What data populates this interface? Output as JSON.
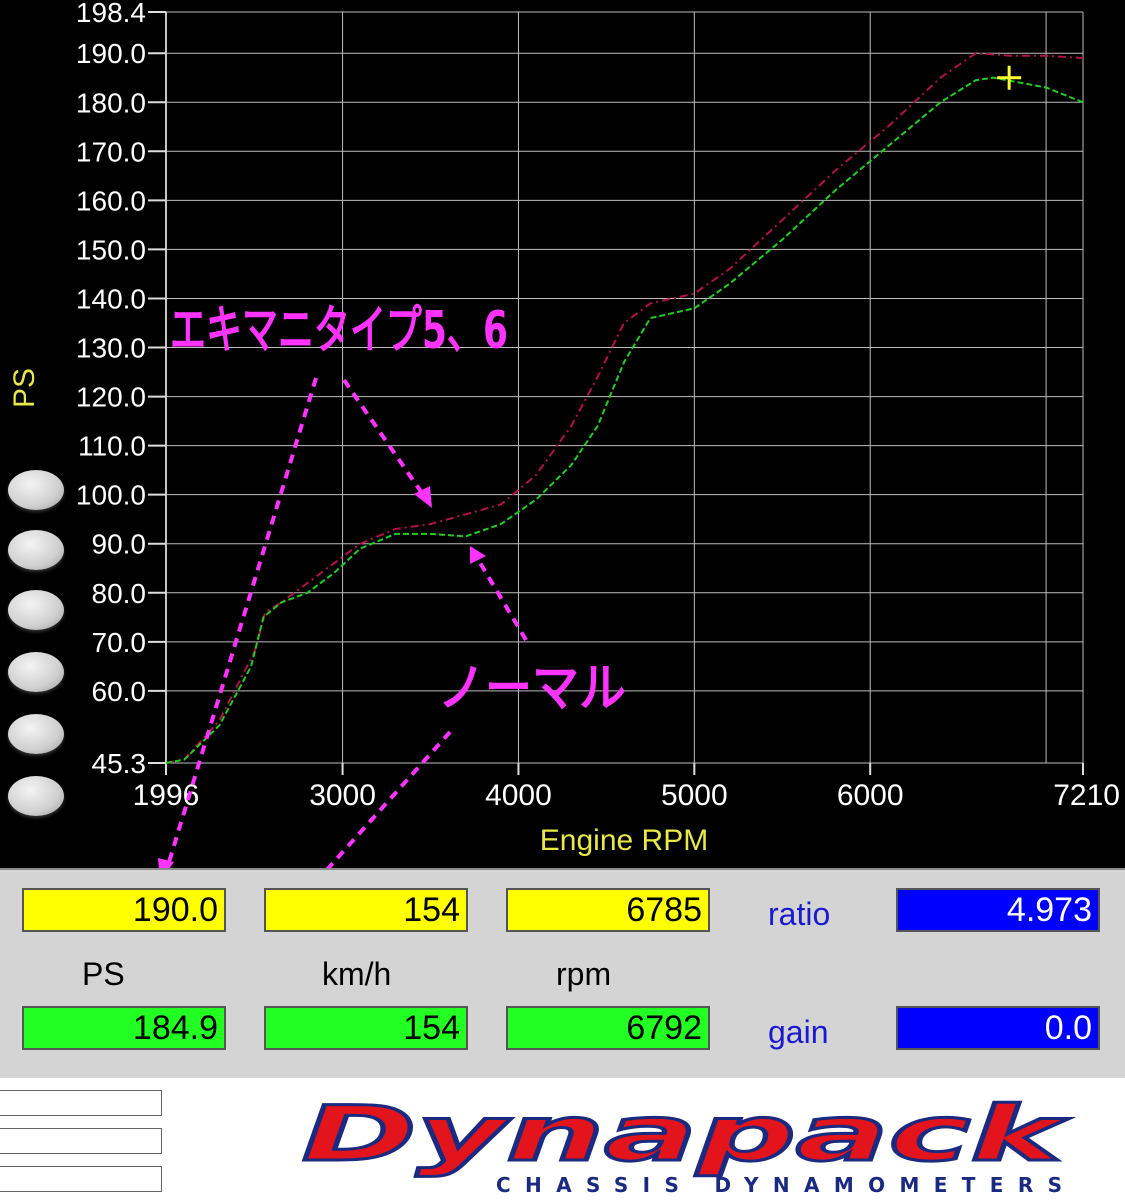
{
  "chart_data": {
    "type": "line",
    "xlabel": "Engine RPM",
    "ylabel": "PS",
    "xlim": [
      1996,
      7210
    ],
    "ylim": [
      45.3,
      198.4
    ],
    "x_ticks": [
      "1996",
      "3000",
      "4000",
      "5000",
      "6000",
      "7210"
    ],
    "y_ticks": [
      "198.4",
      "190.0",
      "180.0",
      "170.0",
      "160.0",
      "150.0",
      "140.0",
      "130.0",
      "120.0",
      "110.0",
      "100.0",
      "90.0",
      "80.0",
      "70.0",
      "60.0",
      "45.3"
    ],
    "series": [
      {
        "color": "#b0124a",
        "points": [
          [
            1996,
            45.3
          ],
          [
            2100,
            46
          ],
          [
            2300,
            54
          ],
          [
            2500,
            68
          ],
          [
            2560,
            76
          ],
          [
            2650,
            78
          ],
          [
            2800,
            82
          ],
          [
            2950,
            86
          ],
          [
            3100,
            90
          ],
          [
            3300,
            93
          ],
          [
            3500,
            94
          ],
          [
            3700,
            96
          ],
          [
            3900,
            98
          ],
          [
            4100,
            104
          ],
          [
            4300,
            114
          ],
          [
            4450,
            124
          ],
          [
            4600,
            135
          ],
          [
            4750,
            139
          ],
          [
            5000,
            141
          ],
          [
            5200,
            146
          ],
          [
            5500,
            156
          ],
          [
            5800,
            166
          ],
          [
            6100,
            175
          ],
          [
            6400,
            185
          ],
          [
            6600,
            190
          ],
          [
            6800,
            189.5
          ],
          [
            7000,
            189.5
          ],
          [
            7210,
            189
          ]
        ]
      },
      {
        "color": "#22cc22",
        "points": [
          [
            1996,
            45.3
          ],
          [
            2100,
            46
          ],
          [
            2300,
            53
          ],
          [
            2480,
            65
          ],
          [
            2550,
            75
          ],
          [
            2650,
            78
          ],
          [
            2800,
            80
          ],
          [
            2950,
            84
          ],
          [
            3100,
            89
          ],
          [
            3300,
            92
          ],
          [
            3500,
            92
          ],
          [
            3700,
            91.5
          ],
          [
            3900,
            94
          ],
          [
            4100,
            99
          ],
          [
            4300,
            106
          ],
          [
            4450,
            114
          ],
          [
            4600,
            127
          ],
          [
            4750,
            136
          ],
          [
            5000,
            138
          ],
          [
            5200,
            143
          ],
          [
            5500,
            152
          ],
          [
            5800,
            162
          ],
          [
            6100,
            171
          ],
          [
            6400,
            180
          ],
          [
            6600,
            184.5
          ],
          [
            6700,
            185
          ],
          [
            6850,
            184
          ],
          [
            7000,
            183
          ],
          [
            7210,
            180
          ]
        ]
      }
    ],
    "marker": {
      "x": 6790,
      "y": 185,
      "color": "#ffff33"
    }
  },
  "annotations": {
    "modified_label": "エキマニタイプ5、6",
    "normal_label": "ノーマル"
  },
  "readout": {
    "row1": {
      "ps": "190.0",
      "kmh": "154",
      "rpm": "6785",
      "ratio_label": "ratio",
      "ratio": "4.973"
    },
    "units": {
      "ps": "PS",
      "kmh": "km/h",
      "rpm": "rpm"
    },
    "row2": {
      "ps": "184.9",
      "kmh": "154",
      "rpm": "6792",
      "gain_label": "gain",
      "gain": "0.0"
    }
  },
  "colors": {
    "modified": "#b0124a",
    "normal": "#22cc22",
    "annotation": "#ff33ff"
  },
  "footer": {
    "logo_text": "Dynapack",
    "logo_sub": "CHASSIS   DYNAMOMETERS"
  }
}
